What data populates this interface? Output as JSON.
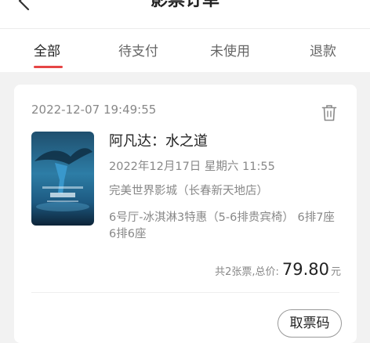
{
  "header": {
    "title": "影票订单",
    "back_icon": "chevron-left-icon"
  },
  "tabs": [
    {
      "label": "全部",
      "active": true
    },
    {
      "label": "待支付",
      "active": false
    },
    {
      "label": "未使用",
      "active": false
    },
    {
      "label": "退款",
      "active": false
    }
  ],
  "colors": {
    "accent": "#e64545",
    "background": "#f2f2f2",
    "card": "#ffffff",
    "text_primary": "#222222",
    "text_secondary": "#888888"
  },
  "order": {
    "order_time": "2022-12-07 19:49:55",
    "delete_icon": "trash-icon",
    "poster_icon": "movie-poster-image",
    "movie_title": "阿凡达：水之道",
    "show_time": "2022年12月17日 星期六 11:55",
    "cinema": "完美世界影城（长春新天地店）",
    "hall_seats": "6号厅-冰淇淋3特惠（5-6排贵宾椅） 6排7座 6排6座",
    "price_label": "共2张票,总价:",
    "price_value": "79.80",
    "price_unit": "元",
    "ticket_button": "取票码"
  }
}
